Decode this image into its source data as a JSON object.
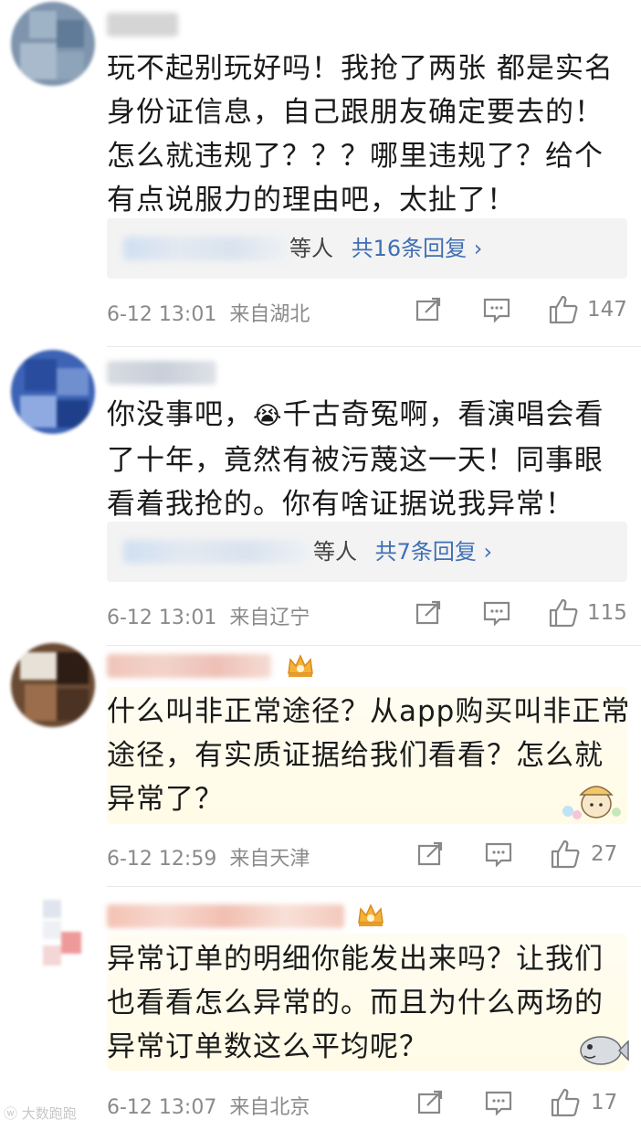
{
  "comments": [
    {
      "text": "玩不起别玩好吗！我抢了两张 都是实名身份证信息，自己跟朋友确定要去的！怎么就违规了？？？哪里违规了？给个有点说服力的理由吧，太扯了！",
      "replies": {
        "suffix": "等人",
        "count_label": "共16条回复 ›"
      },
      "time": "6-12 13:01",
      "location": "来自湖北",
      "likes": "147"
    },
    {
      "text_before_emoji": "你没事吧，",
      "emoji": "😭",
      "text_after_emoji": "千古奇冤啊，看演唱会看了十年，竟然有被污蔑这一天！同事眼看着我抢的。你有啥证据说我异常！",
      "replies": {
        "suffix": "等人",
        "count_label": "共7条回复 ›"
      },
      "time": "6-12 13:01",
      "location": "来自辽宁",
      "likes": "115"
    },
    {
      "text": "什么叫非正常途径？从app购买叫非正常途径，有实质证据给我们看看？怎么就异常了？",
      "time": "6-12 12:59",
      "location": "来自天津",
      "likes": "27",
      "badge_icon": "vip-crown-icon"
    },
    {
      "text": "异常订单的明细你能发出来吗？让我们也看看怎么异常的。而且为什么两场的异常订单数这么平均呢？",
      "time": "6-12 13:07",
      "location": "来自北京",
      "likes": "17",
      "badge_icon": "vip-crown-icon"
    }
  ],
  "watermark": "大数跑跑",
  "icons": {
    "share": "share-icon",
    "comment": "comment-icon",
    "like": "thumbs-up-icon"
  },
  "colors": {
    "link": "#3f6fb4",
    "meta": "#8a8a8a",
    "reply_bg": "#f3f3f3"
  }
}
